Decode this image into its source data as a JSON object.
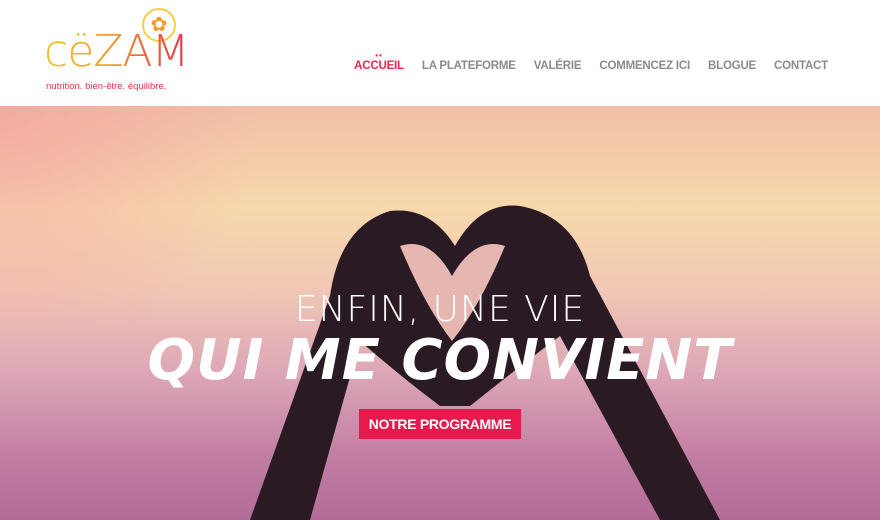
{
  "logo": {
    "word": "cëZAM",
    "tagline": "nutrition. bien-être. équilibre."
  },
  "nav": [
    "ACCUEIL",
    "LA PLATEFORME",
    "VALÉRIE",
    "COMMENCEZ ICI",
    "BLOGUE",
    "CONTACT"
  ],
  "hero": {
    "line1": "ENFIN, UNE VIE",
    "line2": "QUI ME CONVIENT",
    "button": "NOTRE PROGRAMME"
  },
  "colors": {
    "accent": "#e8194d",
    "nav": "#8b8b8b"
  }
}
